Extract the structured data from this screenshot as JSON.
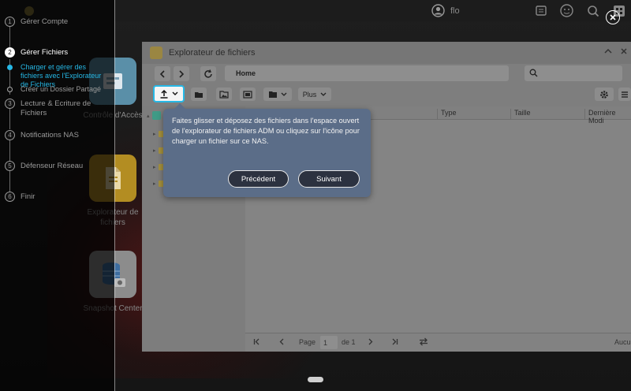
{
  "topbar": {
    "username": "flo"
  },
  "desktop": {
    "icons": [
      {
        "label": "Contrôle d'Accès",
        "icon": "access-control-icon"
      },
      {
        "label": "Explorateur de fichiers",
        "icon": "file-explorer-icon"
      },
      {
        "label": "Snapshot Center",
        "icon": "snapshot-center-icon"
      }
    ]
  },
  "window": {
    "title": "Explorateur de fichiers",
    "path": "Home",
    "toolbar": {
      "plus_label": "Plus"
    },
    "columns": [
      "Type",
      "Taille",
      "Dernière Modi"
    ],
    "pager": {
      "page_label": "Page",
      "page_value": "1",
      "of_label": "de 1",
      "status": "Aucun"
    }
  },
  "wizard": {
    "steps": [
      {
        "num": "1",
        "label": "Gérer Compte",
        "active": false
      },
      {
        "num": "2",
        "label": "Gérer Fichiers",
        "active": true
      },
      {
        "num": "3",
        "label": "Lecture & Ecriture de Fichiers",
        "active": false
      },
      {
        "num": "4",
        "label": "Notifications NAS",
        "active": false
      },
      {
        "num": "5",
        "label": "Défenseur Réseau",
        "active": false
      },
      {
        "num": "6",
        "label": "Finir",
        "active": false
      }
    ],
    "substeps": [
      {
        "label": "Charger et gérer des fichiers avec l'Explorateur de Fichiers",
        "active": true
      },
      {
        "label": "Créer un Dossier Partagé",
        "active": false
      }
    ]
  },
  "tooltip": {
    "text": "Faites glisser et déposez des fichiers dans l'espace ouvert de l'explorateur de fichiers ADM ou cliquez sur l'icône pour charger un fichier sur ce NAS.",
    "prev_label": "Précédent",
    "next_label": "Suivant"
  },
  "colors": {
    "accent": "#26b8e6",
    "tooltip_bg": "#5b6d88"
  }
}
